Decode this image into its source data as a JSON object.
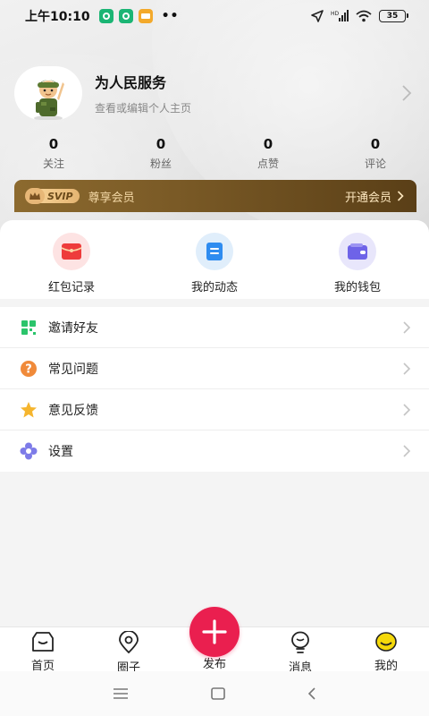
{
  "status_bar": {
    "time": "上午10:10",
    "dots": "••",
    "battery": "35"
  },
  "profile": {
    "name": "为人民服务",
    "subtitle": "查看或编辑个人主页"
  },
  "stats": [
    {
      "value": "0",
      "label": "关注"
    },
    {
      "value": "0",
      "label": "粉丝"
    },
    {
      "value": "0",
      "label": "点赞"
    },
    {
      "value": "0",
      "label": "评论"
    }
  ],
  "vip": {
    "badge": "SVIP",
    "label": "尊享会员",
    "action": "开通会员"
  },
  "quick_actions": [
    {
      "label": "红包记录",
      "icon": "red-packet-icon"
    },
    {
      "label": "我的动态",
      "icon": "feed-icon"
    },
    {
      "label": "我的钱包",
      "icon": "wallet-icon"
    }
  ],
  "menu": [
    {
      "label": "邀请好友",
      "icon": "invite-icon"
    },
    {
      "label": "常见问题",
      "icon": "question-icon"
    },
    {
      "label": "意见反馈",
      "icon": "feedback-star-icon"
    },
    {
      "label": "设置",
      "icon": "settings-flower-icon"
    }
  ],
  "tabs": [
    {
      "label": "首页",
      "icon": "home-icon"
    },
    {
      "label": "圈子",
      "icon": "circle-location-icon"
    },
    {
      "label": "发布",
      "icon": "plus-icon"
    },
    {
      "label": "消息",
      "icon": "bulb-message-icon"
    },
    {
      "label": "我的",
      "icon": "profile-smile-icon"
    }
  ],
  "colors": {
    "accent": "#ea1f4f",
    "vip_gold": "#f5cf92",
    "vip_brown": "#7a5a26"
  }
}
